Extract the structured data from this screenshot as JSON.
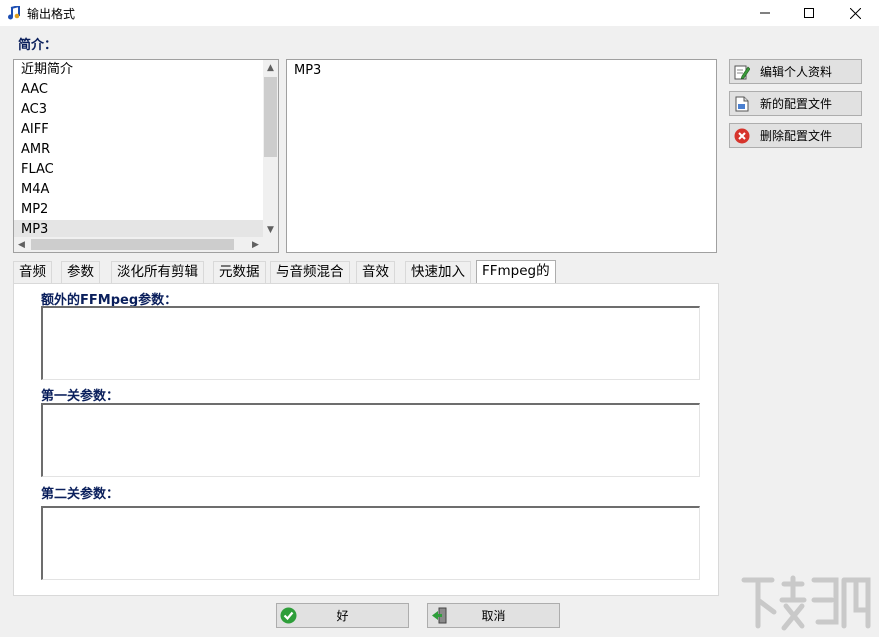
{
  "window": {
    "title": "输出格式",
    "icons": {
      "app": "music-note-icon",
      "minimize": "minimize-icon",
      "maximize": "maximize-icon",
      "close": "close-icon"
    }
  },
  "profiles": {
    "label": "简介：",
    "items": [
      "近期简介",
      "AAC",
      "AC3",
      "AIFF",
      "AMR",
      "FLAC",
      "M4A",
      "MP2",
      "MP3"
    ],
    "selected": "MP3",
    "detail": "MP3"
  },
  "side_buttons": {
    "edit": {
      "label": "编辑个人资料",
      "icon": "edit-document-icon"
    },
    "new": {
      "label": "新的配置文件",
      "icon": "new-file-icon"
    },
    "delete": {
      "label": "删除配置文件",
      "icon": "delete-icon"
    }
  },
  "tabs": [
    "音频",
    "参数",
    "淡化所有剪辑",
    "元数据",
    "与音频混合",
    "音效",
    "快速加入",
    "FFmpeg的"
  ],
  "active_tab": "FFmpeg的",
  "ffmpeg": {
    "extra_label": "额外的FFMpeg参数：",
    "first_pass_label": "第一关参数：",
    "second_pass_label": "第二关参数：",
    "extra_value": "",
    "first_pass_value": "",
    "second_pass_value": ""
  },
  "bottom": {
    "ok": {
      "label": "好",
      "icon": "checkmark-icon"
    },
    "cancel": {
      "label": "取消",
      "icon": "exit-door-icon"
    }
  },
  "colors": {
    "label_blue": "#0a1f5c",
    "ok_green": "#2e9e3a",
    "delete_red": "#d6342c"
  }
}
